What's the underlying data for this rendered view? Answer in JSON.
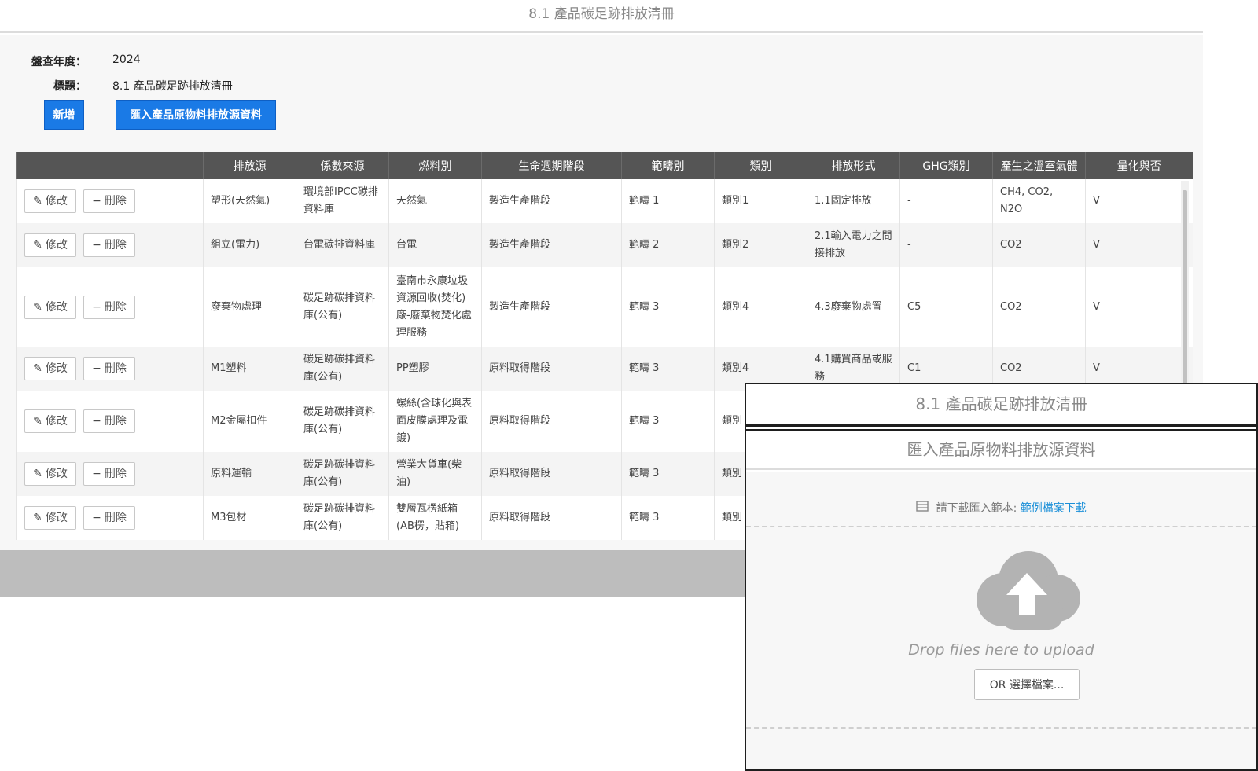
{
  "page": {
    "title": "8.1 產品碳足跡排放清冊"
  },
  "meta": {
    "year_label": "盤查年度：",
    "year_value": "2024",
    "title_label": "標題：",
    "title_value": "8.1 產品碳足跡排放清冊"
  },
  "toolbar": {
    "add_label": "新增",
    "import_label": "匯入產品原物料排放源資料"
  },
  "table": {
    "headers": [
      "",
      "排放源",
      "係數來源",
      "燃料別",
      "生命週期階段",
      "範疇別",
      "類別",
      "排放形式",
      "GHG類別",
      "產生之溫室氣體",
      "量化與否"
    ],
    "edit_label": "修改",
    "delete_label": "刪除",
    "rows": [
      {
        "source": "塑形(天然氣)",
        "factor": "環境部IPCC碳排資料庫",
        "fuel": "天然氣",
        "stage": "製造生產階段",
        "scope": "範疇 1",
        "category": "類別1",
        "form": "1.1固定排放",
        "ghg": "-",
        "gas": "CH4, CO2, N2O",
        "quant": "V"
      },
      {
        "source": "組立(電力)",
        "factor": "台電碳排資料庫",
        "fuel": "台電",
        "stage": "製造生產階段",
        "scope": "範疇 2",
        "category": "類別2",
        "form": "2.1輸入電力之間接排放",
        "ghg": "-",
        "gas": "CO2",
        "quant": "V"
      },
      {
        "source": "廢棄物處理",
        "factor": "碳足跡碳排資料庫(公有)",
        "fuel": "臺南市永康垃圾資源回收(焚化)廠-廢棄物焚化處理服務",
        "stage": "製造生產階段",
        "scope": "範疇 3",
        "category": "類別4",
        "form": "4.3廢棄物處置",
        "ghg": "C5",
        "gas": "CO2",
        "quant": "V"
      },
      {
        "source": "M1塑料",
        "factor": "碳足跡碳排資料庫(公有)",
        "fuel": "PP塑膠",
        "stage": "原料取得階段",
        "scope": "範疇 3",
        "category": "類別4",
        "form": "4.1購買商品或服務",
        "ghg": "C1",
        "gas": "CO2",
        "quant": "V"
      },
      {
        "source": "M2金屬扣件",
        "factor": "碳足跡碳排資料庫(公有)",
        "fuel": "螺絲(含球化與表面皮膜處理及電鍍)",
        "stage": "原料取得階段",
        "scope": "範疇 3",
        "category": "類別",
        "form": "",
        "ghg": "",
        "gas": "",
        "quant": ""
      },
      {
        "source": "原料運輸",
        "factor": "碳足跡碳排資料庫(公有)",
        "fuel": "營業大貨車(柴油)",
        "stage": "原料取得階段",
        "scope": "範疇 3",
        "category": "類別",
        "form": "",
        "ghg": "",
        "gas": "",
        "quant": ""
      },
      {
        "source": "M3包材",
        "factor": "碳足跡碳排資料庫(公有)",
        "fuel": "雙層瓦楞紙箱(AB楞，貼箱)",
        "stage": "原料取得階段",
        "scope": "範疇 3",
        "category": "類別",
        "form": "",
        "ghg": "",
        "gas": "",
        "quant": ""
      }
    ]
  },
  "dialog": {
    "title": "8.1 產品碳足跡排放清冊",
    "subtitle": "匯入產品原物料排放源資料",
    "download_prompt": "請下載匯入範本:",
    "download_link": "範例檔案下載",
    "drop_text": "Drop files here to upload",
    "choose_button": "OR 選擇檔案..."
  },
  "icons": {
    "edit": "pencil-icon",
    "delete": "minus-icon",
    "template": "file-icon",
    "upload": "cloud-upload-icon"
  },
  "colors": {
    "primary": "#1a7ae6",
    "header": "#555555",
    "link": "#1a8fd8"
  }
}
